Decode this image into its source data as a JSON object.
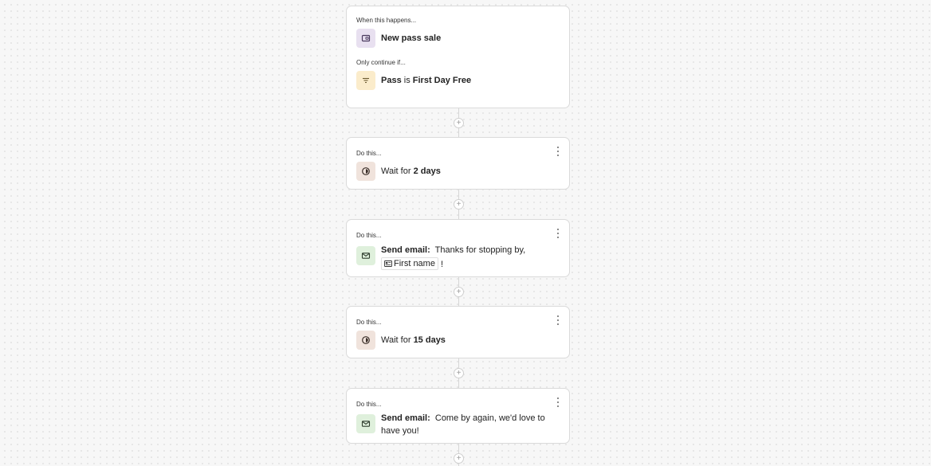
{
  "colors": {
    "trigger_icon_bg": "#e8e0f0",
    "filter_icon_bg": "#fbeccb",
    "wait_icon_bg": "#f0e3dc",
    "email_icon_bg": "#dff0dc"
  },
  "trigger_card": {
    "when_label": "When this happens...",
    "trigger_icon": "wallet-icon",
    "trigger_text": "New pass sale",
    "condition_label": "Only continue if...",
    "filter_icon": "filter-icon",
    "condition_field": "Pass",
    "condition_operator": "is",
    "condition_value": "First Day Free"
  },
  "steps": [
    {
      "label": "Do this...",
      "icon": "timer-icon",
      "action_prefix": "Wait for",
      "action_value": "2 days"
    },
    {
      "label": "Do this...",
      "icon": "mail-icon",
      "action_prefix": "Send email:",
      "action_value": "Thanks for stopping by,",
      "token_icon": "id-card-icon",
      "token_label": "First name",
      "suffix": "!"
    },
    {
      "label": "Do this...",
      "icon": "timer-icon",
      "action_prefix": "Wait for",
      "action_value": "15 days"
    },
    {
      "label": "Do this...",
      "icon": "mail-icon",
      "action_prefix": "Send email:",
      "action_value": "Come by again, we'd love to have you!"
    }
  ],
  "add_step_symbol": "+"
}
